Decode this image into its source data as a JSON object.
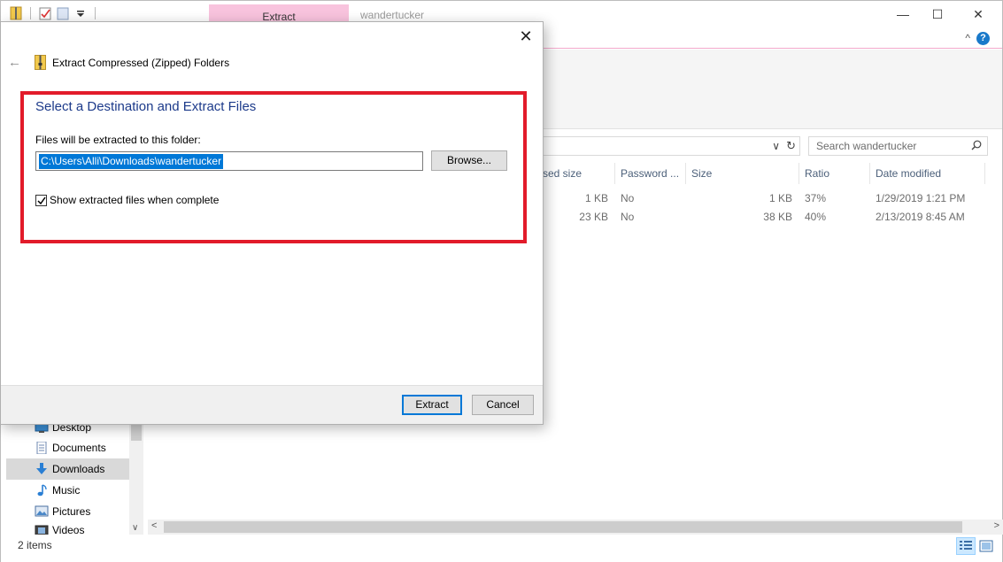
{
  "explorer": {
    "context_tab": "Extract",
    "window_title": "wandertucker",
    "window_controls": {
      "minimize": "—",
      "maximize": "☐",
      "close": "✕"
    },
    "ribbon_controls": {
      "collapse": "^",
      "help": "?"
    },
    "search_placeholder": "Search wandertucker",
    "address_dropdown": "∨",
    "address_refresh": "↻",
    "columns": {
      "compressed_size": "ssed size",
      "password": "Password ...",
      "size": "Size",
      "ratio": "Ratio",
      "date_modified": "Date modified"
    },
    "rows": [
      {
        "compressed_size": "1 KB",
        "password": "No",
        "size": "1 KB",
        "ratio": "37%",
        "date_modified": "1/29/2019 1:21 PM"
      },
      {
        "compressed_size": "23 KB",
        "password": "No",
        "size": "38 KB",
        "ratio": "40%",
        "date_modified": "2/13/2019 8:45 AM"
      }
    ],
    "nav_items": [
      {
        "label": "Desktop",
        "icon": "desktop-icon"
      },
      {
        "label": "Documents",
        "icon": "documents-icon"
      },
      {
        "label": "Downloads",
        "icon": "downloads-icon",
        "selected": true
      },
      {
        "label": "Music",
        "icon": "music-icon"
      },
      {
        "label": "Pictures",
        "icon": "pictures-icon"
      },
      {
        "label": "Videos",
        "icon": "videos-icon"
      }
    ],
    "status": "2 items"
  },
  "dialog": {
    "title": "Extract Compressed (Zipped) Folders",
    "heading": "Select a Destination and Extract Files",
    "folder_label": "Files will be extracted to this folder:",
    "path_value": "C:\\Users\\Alli\\Downloads\\wandertucker",
    "browse_label": "Browse...",
    "checkbox_label": "Show extracted files when complete",
    "checkbox_checked": true,
    "extract_label": "Extract",
    "cancel_label": "Cancel",
    "close_glyph": "✕",
    "back_glyph": "←"
  },
  "colors": {
    "accent": "#0078d7",
    "highlight_border": "#e21b2a",
    "context_tab": "#f8c3dd",
    "heading": "#1c3a8a"
  }
}
